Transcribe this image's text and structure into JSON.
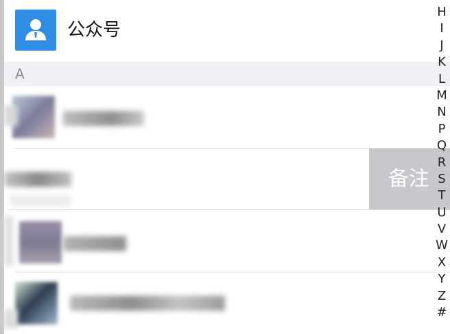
{
  "public_accounts": {
    "label": "公众号",
    "icon": "person-icon",
    "color": "#2f8de4"
  },
  "section": {
    "letter": "A"
  },
  "swipe_action": {
    "label": "备注",
    "color": "#c7c7cc"
  },
  "index": [
    "H",
    "I",
    "J",
    "K",
    "L",
    "M",
    "N",
    "P",
    "Q",
    "R",
    "S",
    "T",
    "U",
    "V",
    "W",
    "X",
    "Y",
    "Z",
    "#"
  ]
}
